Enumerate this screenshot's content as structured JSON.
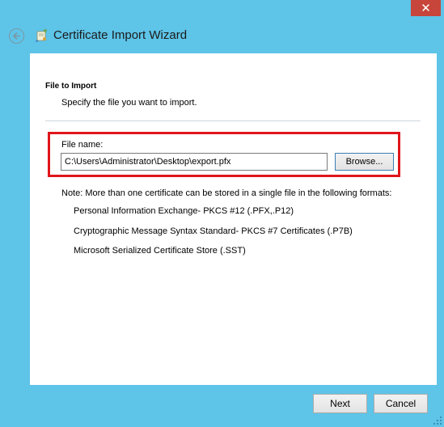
{
  "window": {
    "title": "Certificate Import Wizard",
    "close_glyph": "✕",
    "accent_color": "#5ec4e8",
    "close_color": "#c7453a"
  },
  "page": {
    "section_title": "File to Import",
    "section_desc": "Specify the file you want to import."
  },
  "file": {
    "label": "File name:",
    "value": "C:\\Users\\Administrator\\Desktop\\export.pfx",
    "browse_label": "Browse..."
  },
  "note": {
    "text": "Note:  More than one certificate can be stored in a single file in the following formats:",
    "formats": [
      "Personal Information Exchange- PKCS #12 (.PFX,.P12)",
      "Cryptographic Message Syntax Standard- PKCS #7 Certificates (.P7B)",
      "Microsoft Serialized Certificate Store (.SST)"
    ]
  },
  "footer": {
    "next_label": "Next",
    "cancel_label": "Cancel"
  },
  "icons": {
    "back": "back-arrow-icon",
    "wizard": "certificate-wizard-icon",
    "grip": "resize-grip-icon"
  }
}
